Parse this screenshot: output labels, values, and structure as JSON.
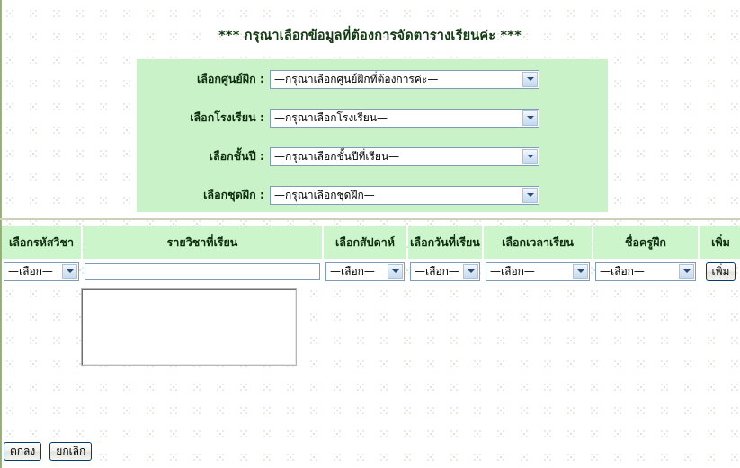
{
  "page": {
    "title": "*** กรุณาเลือกข้อมูลที่ต้องการจัดตารางเรียนค่ะ ***",
    "panel_color": "#c9f2c9",
    "header_color": "#ccf5cc"
  },
  "filters": {
    "fields": [
      {
        "label": "เลือกศูนย์ฝึก :",
        "value": "—กรุณาเลือกศูนย์ฝึกที่ต้องการค่ะ—"
      },
      {
        "label": "เลือกโรงเรียน :",
        "value": "—กรุณาเลือกโรงเรียน—"
      },
      {
        "label": "เลือกชั้นปี :",
        "value": "—กรุณาเลือกชั้นปีที่เรียน—"
      },
      {
        "label": "เลือกชุดฝึก :",
        "value": "—กรุณาเลือกชุดฝึก—"
      }
    ]
  },
  "table": {
    "headers": [
      "เลือกรหัสวิชา",
      "รายวิชาที่เรียน",
      "เลือกสัปดาห์",
      "เลือกวันที่เรียน",
      "เลือกเวลาเรียน",
      "ชื่อครูฝึก",
      "เพิ่ม"
    ],
    "row": {
      "subject_code": "—เลือก—",
      "subject_name": "",
      "subject_name_placeholder": "",
      "week": "—เลือก—",
      "day": "—เลือก—",
      "time": "—เลือก—",
      "teacher": "—เลือก—",
      "add_label": "เพิ่ม"
    }
  },
  "suggestions": {
    "items": []
  },
  "actions": {
    "confirm_label": "ตกลง",
    "cancel_label": "ยกเลิก"
  }
}
